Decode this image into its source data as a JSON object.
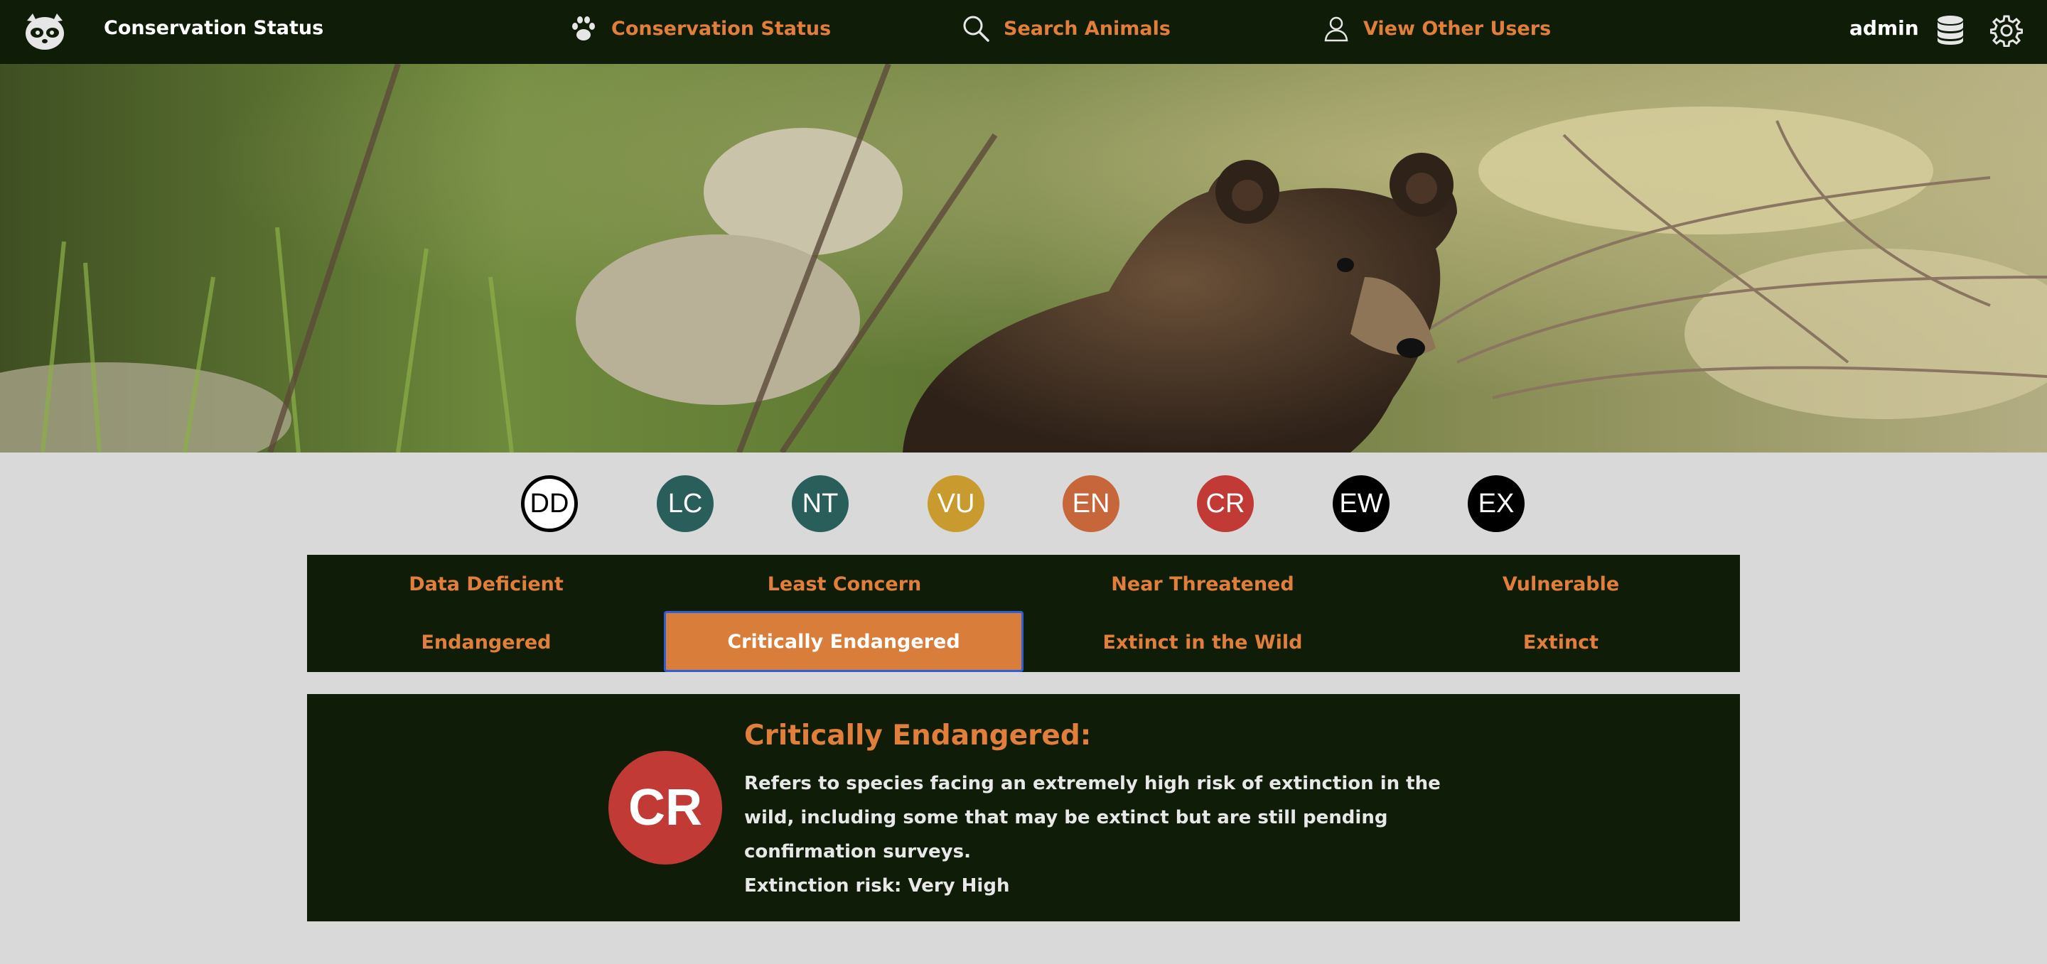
{
  "header": {
    "app_title": "Conservation Status",
    "nav": [
      {
        "label": "Conservation Status",
        "icon": "paw-icon"
      },
      {
        "label": "Search Animals",
        "icon": "search-icon"
      },
      {
        "label": "View Other Users",
        "icon": "user-icon"
      }
    ],
    "username": "admin",
    "right_icons": [
      "database-icon",
      "gear-icon"
    ]
  },
  "hero": {
    "image": "bear-cub-photo"
  },
  "status_circles": [
    "DD",
    "LC",
    "NT",
    "VU",
    "EN",
    "CR",
    "EW",
    "EX"
  ],
  "categories": [
    "Data Deficient",
    "Least Concern",
    "Near Threatened",
    "Vulnerable",
    "Endangered",
    "Critically Endangered",
    "Extinct in the Wild",
    "Extinct"
  ],
  "selected_category": "Critically Endangered",
  "detail": {
    "code": "CR",
    "title": "Critically Endangered:",
    "description": "Refers to species facing an extremely high risk of extinction in the wild, including some that may be extinct but are still pending confirmation surveys.",
    "risk": "Extinction risk: Very High"
  },
  "colors": {
    "nav_bg": "#0f1d08",
    "accent": "#e07e3a",
    "page_bg": "#d9d9d9",
    "LC": "#2a5e5b",
    "NT": "#2a5e5b",
    "VU": "#c99a2e",
    "EN": "#c7663a",
    "CR": "#c13a36",
    "EW": "#000000",
    "EX": "#000000"
  }
}
